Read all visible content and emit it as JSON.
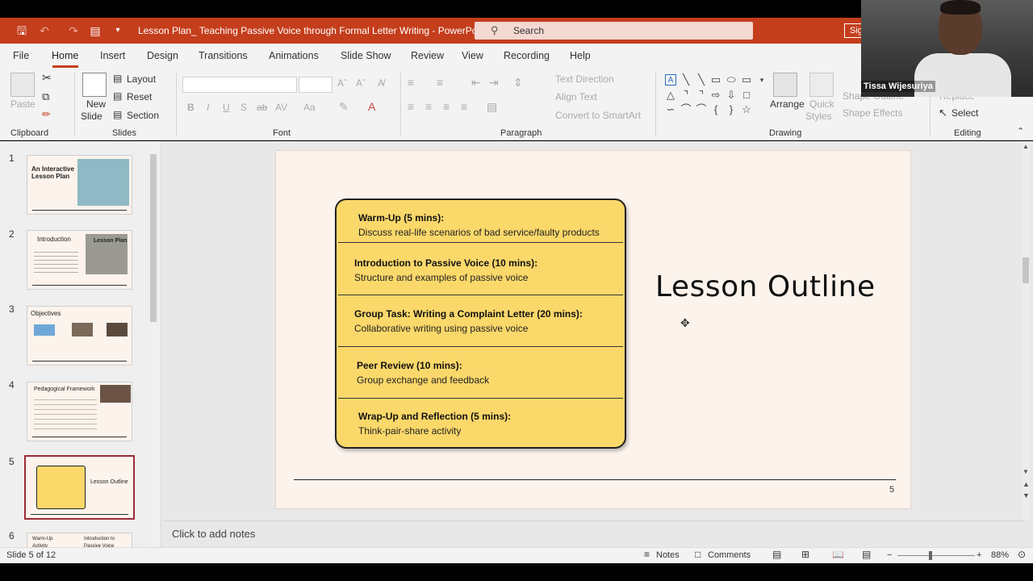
{
  "window": {
    "title": "Lesson Plan_ Teaching Passive Voice through Formal Letter Writing  -  PowerPoint",
    "search_placeholder": "Search",
    "signin_label": "Sig"
  },
  "menu": {
    "tabs": [
      "File",
      "Home",
      "Insert",
      "Design",
      "Transitions",
      "Animations",
      "Slide Show",
      "Review",
      "View",
      "Recording",
      "Help"
    ],
    "active": "Home"
  },
  "ribbon": {
    "clipboard": {
      "paste": "Paste",
      "label": "Clipboard"
    },
    "slides": {
      "new_slide_1": "New",
      "new_slide_2": "Slide",
      "layout": "Layout",
      "reset": "Reset",
      "section": "Section",
      "label": "Slides"
    },
    "font": {
      "label": "Font",
      "bold": "B",
      "italic": "I",
      "underline": "U",
      "strike": "S",
      "spacing": "AV",
      "case": "Aa"
    },
    "paragraph": {
      "label": "Paragraph",
      "text_direction": "Text Direction",
      "align_text": "Align Text",
      "smartart": "Convert to SmartArt"
    },
    "drawing": {
      "label": "Drawing",
      "arrange": "Arrange",
      "quick_styles_1": "Quick",
      "quick_styles_2": "Styles",
      "shape_outline": "Shape Outline",
      "shape_effects": "Shape Effects"
    },
    "editing": {
      "label": "Editing",
      "replace": "Replace",
      "select": "Select"
    }
  },
  "thumbnails": [
    {
      "num": "1",
      "title": "An Interactive Lesson Plan"
    },
    {
      "num": "2",
      "title": "Introduction",
      "sub": "Lesson Plan"
    },
    {
      "num": "3",
      "title": "Objectives"
    },
    {
      "num": "4",
      "title": "Pedagogical Framework"
    },
    {
      "num": "5",
      "title": "Lesson Outline"
    },
    {
      "num": "6",
      "title": "Warm-Up Activity",
      "sub": "Introduction to Passive Voice"
    }
  ],
  "slide": {
    "title": "Lesson Outline",
    "number": "5",
    "items": [
      {
        "heading": "Warm-Up (5 mins):",
        "detail": "Discuss real-life scenarios of bad service/faulty products"
      },
      {
        "heading": "Introduction to Passive Voice (10 mins):",
        "detail": "Structure and examples of passive voice"
      },
      {
        "heading": "Group Task: Writing a Complaint Letter (20 mins):",
        "detail": "Collaborative writing using passive voice"
      },
      {
        "heading": "Peer Review (10 mins):",
        "detail": "Group exchange and feedback"
      },
      {
        "heading": "Wrap-Up and Reflection (5 mins):",
        "detail": "Think-pair-share activity"
      }
    ]
  },
  "notes_placeholder": "Click to add notes",
  "status": {
    "slide_info": "Slide 5 of 12",
    "notes": "Notes",
    "comments": "Comments",
    "zoom": "88%"
  },
  "webcam": {
    "name": "Tissa Wijesuriya"
  },
  "colors": {
    "accent": "#c43e1c",
    "box_fill": "#fbd86a",
    "slide_bg": "#fcf3ec",
    "selection": "#9e2a37"
  }
}
